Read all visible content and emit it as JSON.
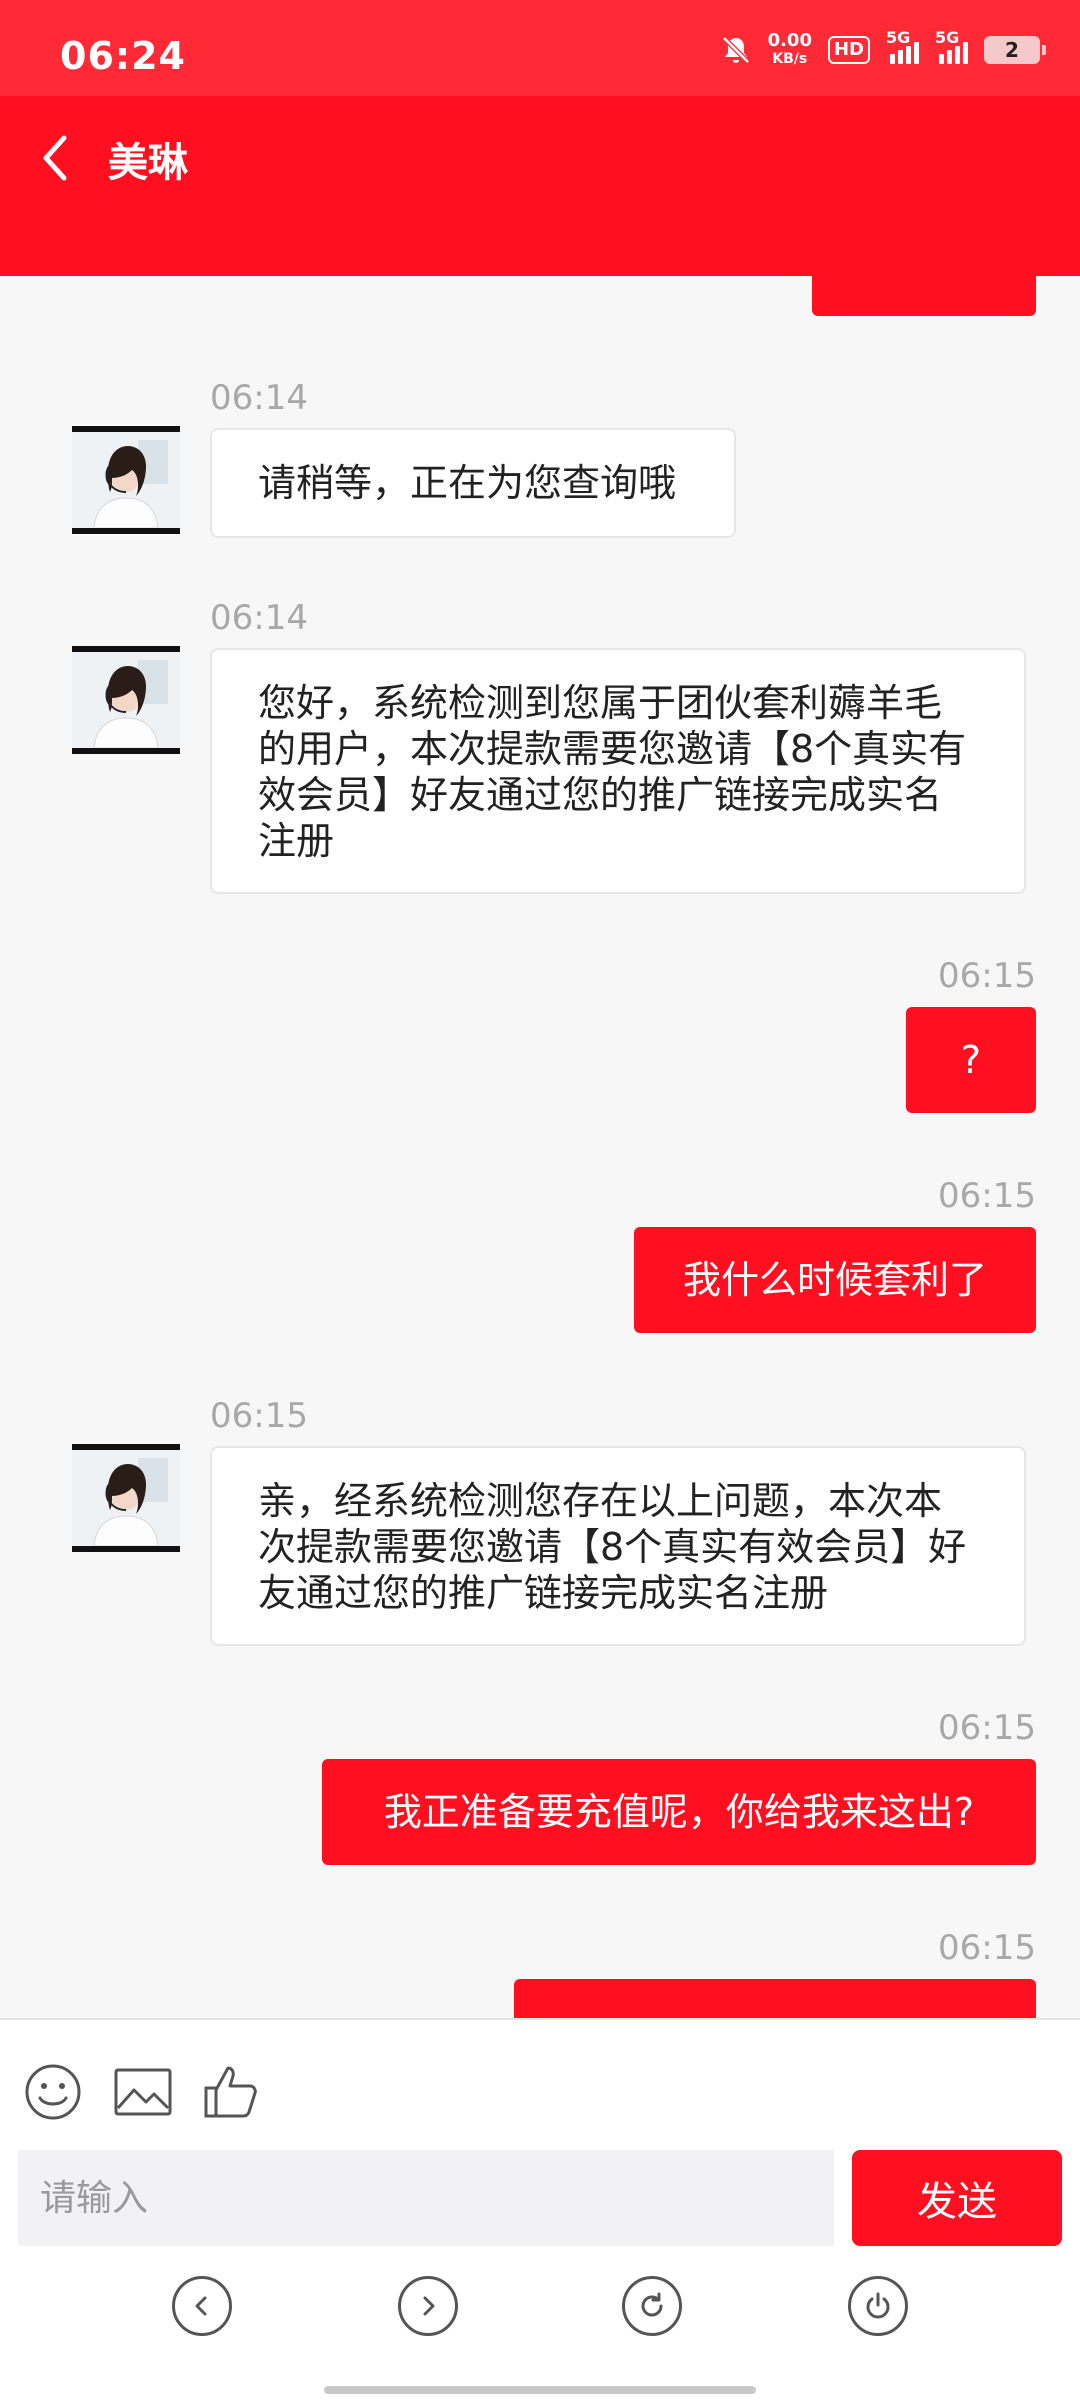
{
  "status_bar": {
    "time": "06:24",
    "net_speed_value": "0.00",
    "net_speed_unit": "KB/s",
    "hd_label": "HD",
    "signal1_label": "5G",
    "signal2_label": "5G",
    "battery_level": "2"
  },
  "header": {
    "title": "美琳",
    "back_icon": "chevron-left-icon"
  },
  "messages": [
    {
      "side": "in",
      "time": "06:14",
      "text": "请稍等，正在为您查询哦"
    },
    {
      "side": "in",
      "time": "06:14",
      "text": "您好，系统检测到您属于团伙套利薅羊毛的用户，本次提款需要您邀请【8个真实有效会员】好友通过您的推广链接完成实名注册"
    },
    {
      "side": "out",
      "time": "06:15",
      "text": "?"
    },
    {
      "side": "out",
      "time": "06:15",
      "text": "我什么时候套利了"
    },
    {
      "side": "in",
      "time": "06:15",
      "text": "亲，经系统检测您存在以上问题，本次本次提款需要您邀请【8个真实有效会员】好友通过您的推广链接完成实名注册"
    },
    {
      "side": "out",
      "time": "06:15",
      "text": "我正准备要充值呢，你给我来这出?"
    },
    {
      "side": "out",
      "time": "06:15",
      "text": ""
    }
  ],
  "toolbar": {
    "emoji_icon": "smiley-icon",
    "image_icon": "image-icon",
    "like_icon": "thumbs-up-icon"
  },
  "input": {
    "placeholder": "请输入",
    "value": ""
  },
  "send_button": {
    "label": "发送"
  },
  "system_nav": {
    "back_icon": "circle-chevron-left-icon",
    "forward_icon": "circle-chevron-right-icon",
    "refresh_icon": "refresh-icon",
    "power_icon": "power-icon"
  },
  "colors": {
    "brand_red": "#ff1020",
    "status_red": "#ff2a35",
    "timestamp_gray": "#a8a8a8"
  }
}
